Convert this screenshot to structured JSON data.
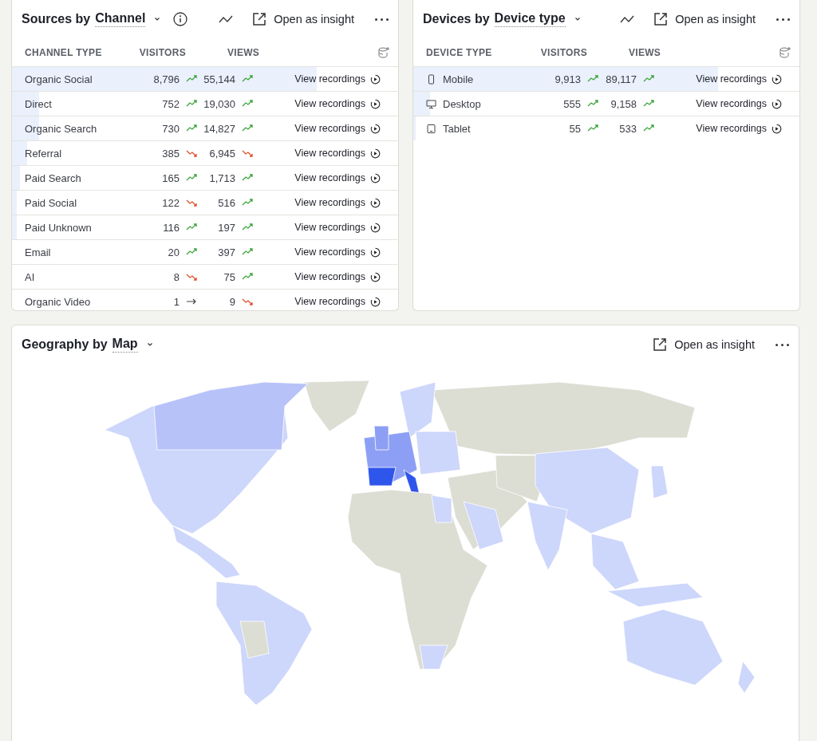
{
  "sources": {
    "title": "Sources by",
    "breakdown": "Channel",
    "action": "Open as insight",
    "columns": [
      "CHANNEL TYPE",
      "VISITORS",
      "VIEWS"
    ],
    "rows": [
      {
        "name": "Organic Social",
        "visitors": "8,796",
        "visitors_trend": {
          "kind": "up"
        },
        "views": "55,144",
        "views_trend": {
          "kind": "up"
        },
        "link": "View recordings",
        "level": 0.79
      },
      {
        "name": "Direct",
        "visitors": "752",
        "visitors_trend": {
          "kind": "up"
        },
        "views": "19,030",
        "views_trend": {
          "kind": "up"
        },
        "link": "View recordings",
        "level": 0.07
      },
      {
        "name": "Organic Search",
        "visitors": "730",
        "visitors_trend": {
          "kind": "up"
        },
        "views": "14,827",
        "views_trend": {
          "kind": "up"
        },
        "link": "View recordings",
        "level": 0.07
      },
      {
        "name": "Referral",
        "visitors": "385",
        "visitors_trend": {
          "kind": "down"
        },
        "views": "6,945",
        "views_trend": {
          "kind": "down"
        },
        "link": "View recordings",
        "level": 0.04
      },
      {
        "name": "Paid Search",
        "visitors": "165",
        "visitors_trend": {
          "kind": "up"
        },
        "views": "1,713",
        "views_trend": {
          "kind": "up"
        },
        "link": "View recordings",
        "level": 0.02
      },
      {
        "name": "Paid Social",
        "visitors": "122",
        "visitors_trend": {
          "kind": "down"
        },
        "views": "516",
        "views_trend": {
          "kind": "up"
        },
        "link": "View recordings",
        "level": 0.012
      },
      {
        "name": "Paid Unknown",
        "visitors": "116",
        "visitors_trend": {
          "kind": "up"
        },
        "views": "197",
        "views_trend": {
          "kind": "up"
        },
        "link": "View recordings",
        "level": 0.012
      },
      {
        "name": "Email",
        "visitors": "20",
        "visitors_trend": {
          "kind": "up"
        },
        "views": "397",
        "views_trend": {
          "kind": "up"
        },
        "link": "View recordings"
      },
      {
        "name": "AI",
        "visitors": "8",
        "visitors_trend": {
          "kind": "down"
        },
        "views": "75",
        "views_trend": {
          "kind": "up"
        },
        "link": "View recordings"
      },
      {
        "name": "Organic Video",
        "visitors": "1",
        "visitors_trend": {
          "kind": "flat"
        },
        "views": "9",
        "views_trend": {
          "kind": "down"
        },
        "link": "View recordings"
      }
    ]
  },
  "devices": {
    "title": "Devices by",
    "breakdown": "Device type",
    "action": "Open as insight",
    "columns": [
      "DEVICE TYPE",
      "VISITORS",
      "VIEWS"
    ],
    "rows": [
      {
        "kind": "phone",
        "name": "Mobile",
        "visitors": "9,913",
        "visitors_trend": {
          "kind": "up"
        },
        "views": "89,117",
        "views_trend": {
          "kind": "up"
        },
        "link": "View recordings",
        "level": 0.79
      },
      {
        "kind": "desktop",
        "name": "Desktop",
        "visitors": "555",
        "visitors_trend": {
          "kind": "up"
        },
        "views": "9,158",
        "views_trend": {
          "kind": "up"
        },
        "link": "View recordings",
        "level": 0.044
      },
      {
        "kind": "tablet",
        "name": "Tablet",
        "visitors": "55",
        "visitors_trend": {
          "kind": "up"
        },
        "views": "533",
        "views_trend": {
          "kind": "up"
        },
        "link": "View recordings",
        "level": 0.006
      }
    ]
  },
  "geography": {
    "title": "Geography by",
    "breakdown": "Map",
    "action": "Open as insight"
  }
}
